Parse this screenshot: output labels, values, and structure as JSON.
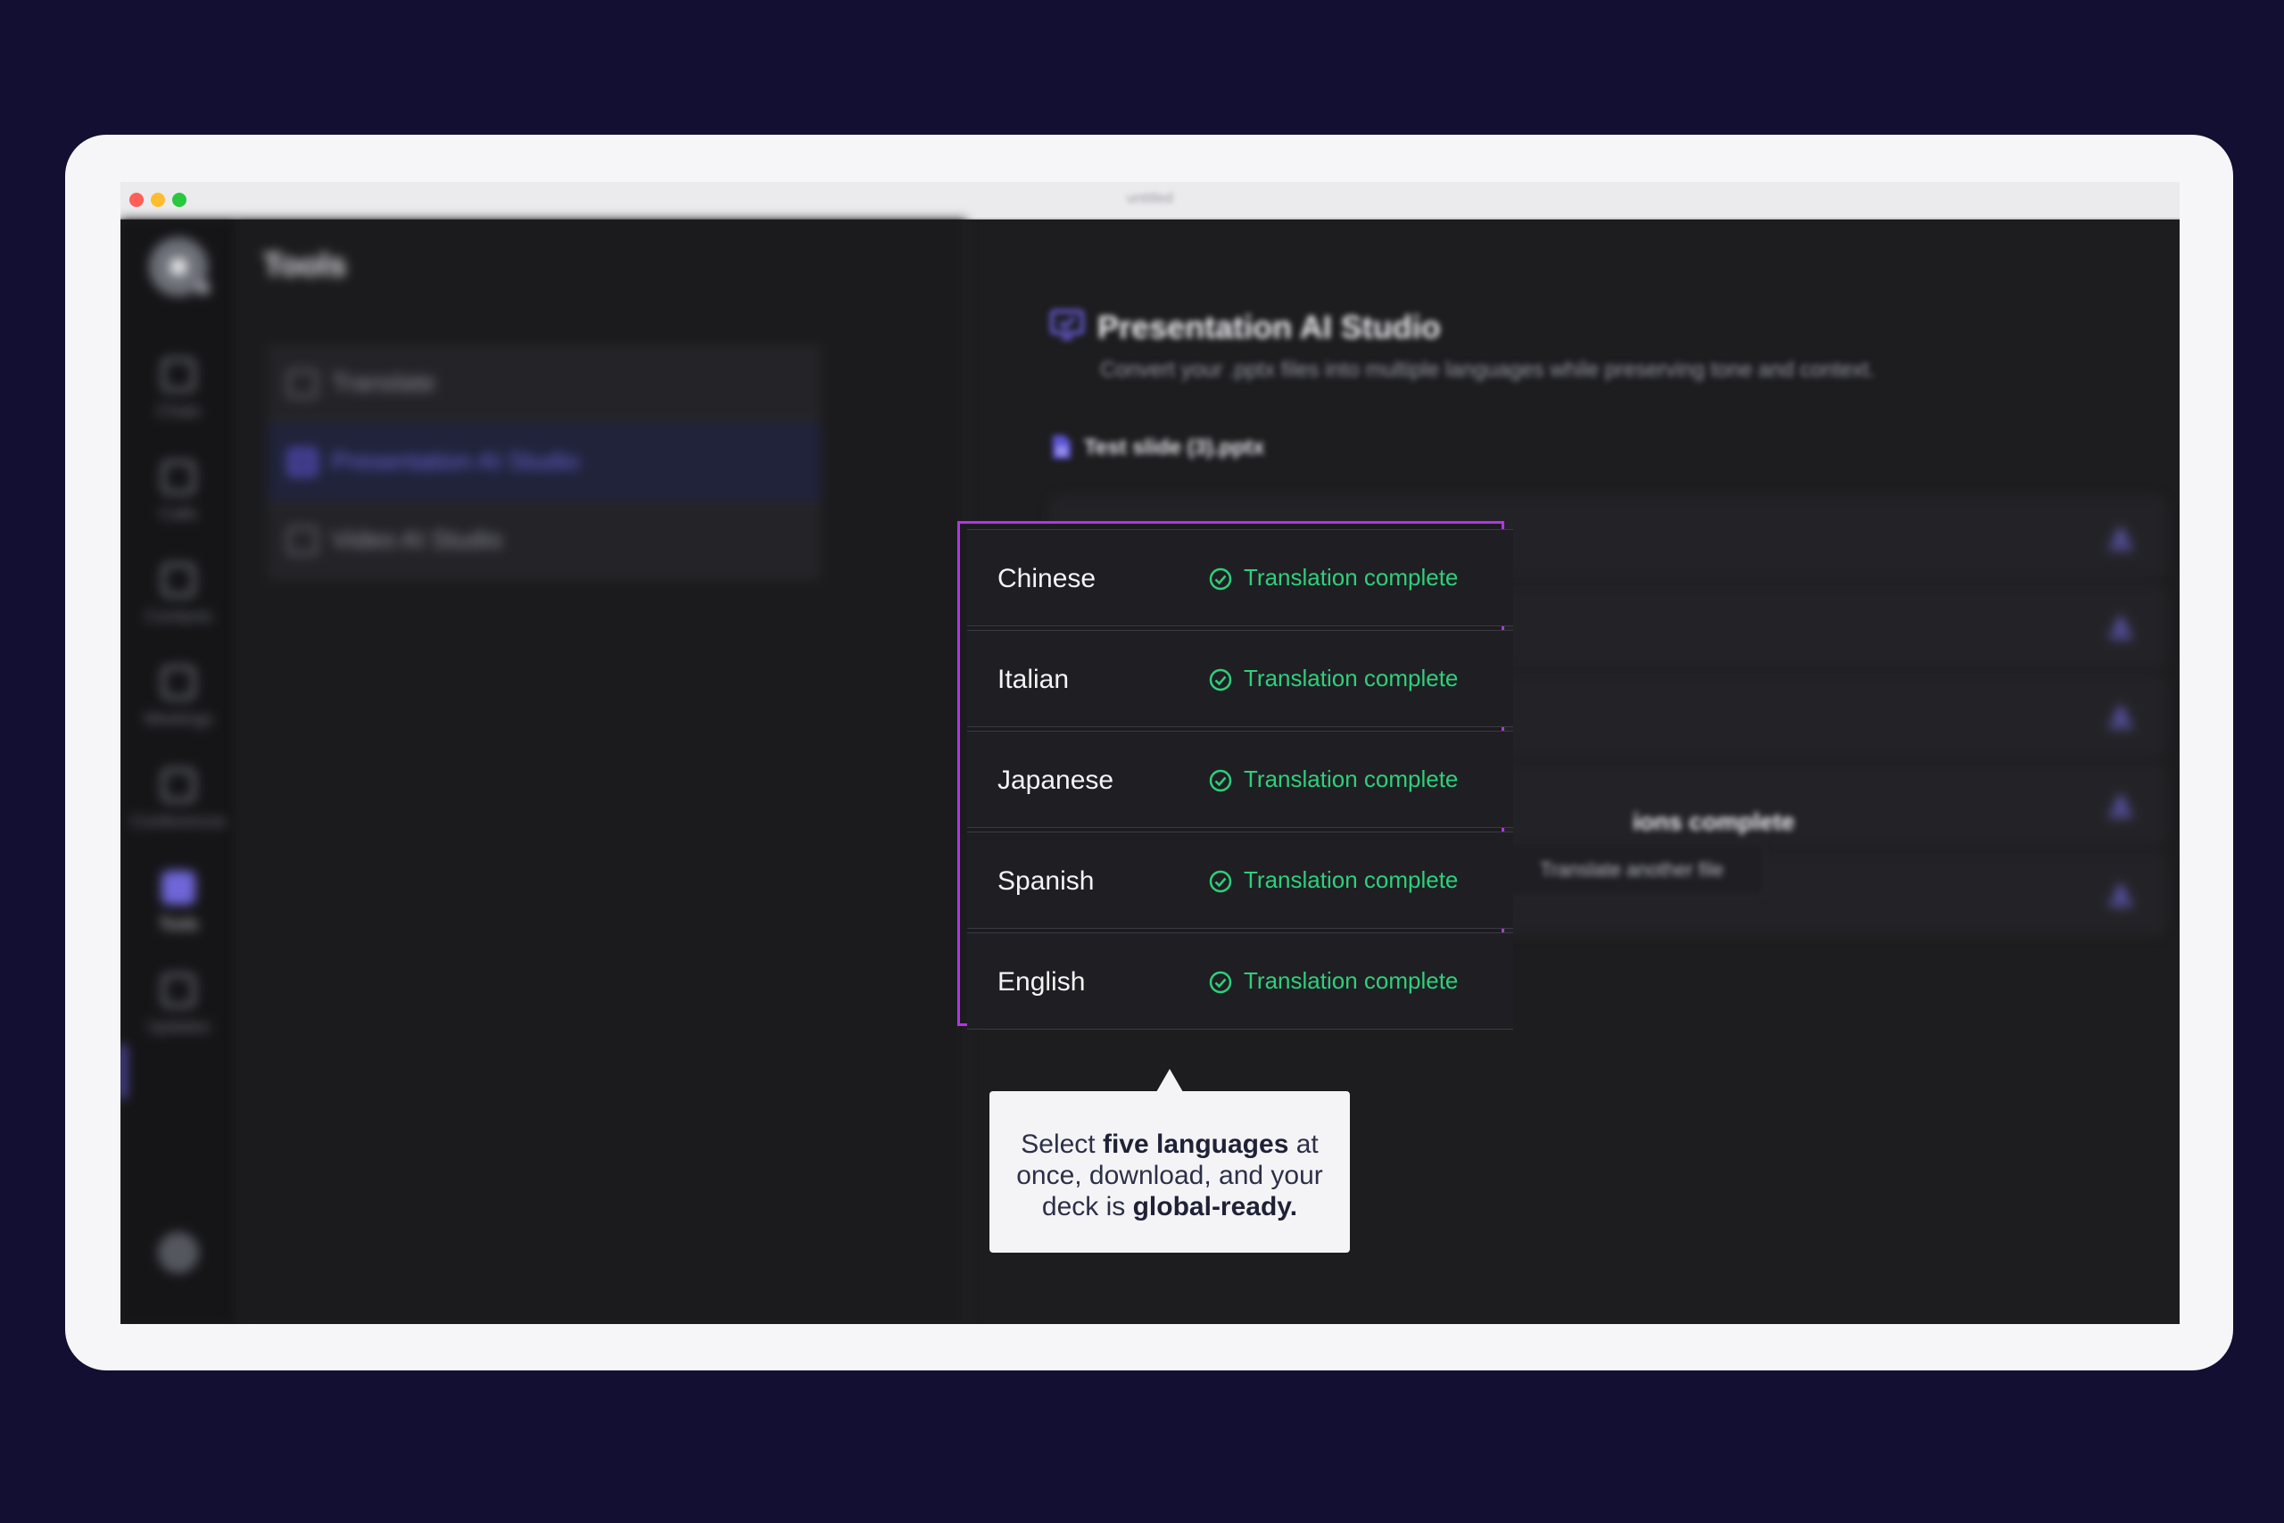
{
  "window": {
    "title": "untitled",
    "traffic_lights": [
      "#ff5f57",
      "#febc2e",
      "#28c840"
    ]
  },
  "rail": {
    "items": [
      {
        "label": "Chats",
        "icon": "chat-icon"
      },
      {
        "label": "Calls",
        "icon": "phone-icon"
      },
      {
        "label": "Contacts",
        "icon": "contacts-icon"
      },
      {
        "label": "Meetings",
        "icon": "calendar-icon"
      },
      {
        "label": "Conferences",
        "icon": "conference-icon"
      },
      {
        "label": "Tools",
        "icon": "wrench-icon",
        "active": true
      },
      {
        "label": "Updates",
        "icon": "updates-icon"
      }
    ]
  },
  "tools_panel": {
    "title": "Tools",
    "items": [
      {
        "label": "Translate",
        "icon": "translate-icon"
      },
      {
        "label": "Presentation AI Studio",
        "icon": "presentation-icon",
        "selected": true
      },
      {
        "label": "Video AI Studio",
        "icon": "video-icon"
      }
    ]
  },
  "main": {
    "title": "Presentation AI Studio",
    "subtitle": "Convert your .pptx files into multiple languages while preserving tone and context.",
    "file_name": "Test slide (3).pptx",
    "languages": [
      {
        "name": "Chinese",
        "status": "Translation complete"
      },
      {
        "name": "Italian",
        "status": "Translation complete"
      },
      {
        "name": "Japanese",
        "status": "Translation complete"
      },
      {
        "name": "Spanish",
        "status": "Translation complete"
      },
      {
        "name": "English",
        "status": "Translation complete"
      }
    ],
    "summary_fragment": "ions complete",
    "another_button": "Translate another file"
  },
  "tooltip": {
    "part1": "Select ",
    "bold1": "five languages",
    "part2": " at once, download, and your deck is ",
    "bold2": "global-ready."
  },
  "colors": {
    "background": "#120f33",
    "accent": "#6b5fe0",
    "highlight_border": "#b235e3",
    "status_green": "#2fcf7b"
  }
}
